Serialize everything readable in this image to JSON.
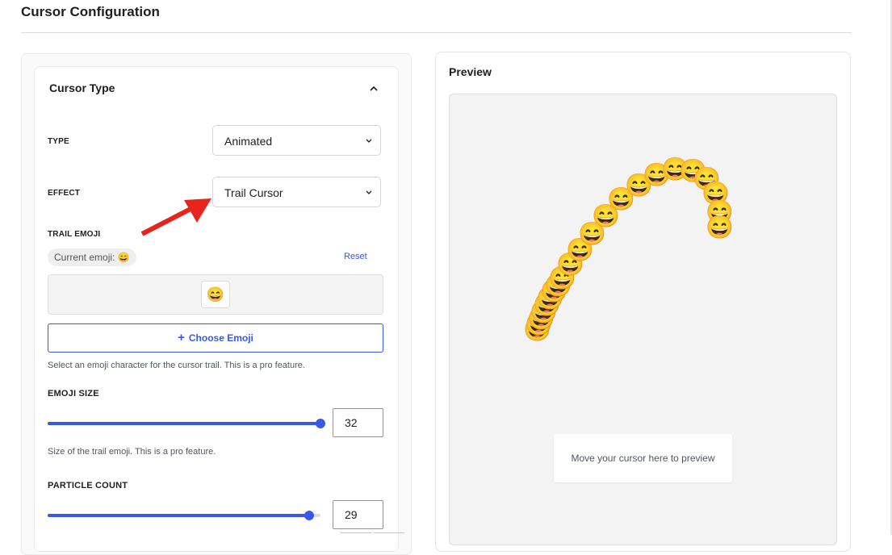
{
  "page": {
    "title": "Cursor Configuration"
  },
  "cursor_type": {
    "title": "Cursor Type",
    "type": {
      "label": "TYPE",
      "value": "Animated"
    },
    "effect": {
      "label": "EFFECT",
      "value": "Trail Cursor"
    },
    "trail_emoji": {
      "label": "TRAIL EMOJI",
      "current_label": "Current emoji: 😄",
      "reset_label": "Reset",
      "selected_emoji": "😄",
      "choose_button": "Choose Emoji",
      "help": "Select an emoji character for the cursor trail. This is a pro feature."
    },
    "emoji_size": {
      "label": "EMOJI SIZE",
      "value": "32",
      "slider_fraction": 1.0,
      "help": "Size of the trail emoji. This is a pro feature."
    },
    "particle_count": {
      "label": "PARTICLE COUNT",
      "value": "29",
      "slider_fraction": 0.96
    }
  },
  "preview": {
    "title": "Preview",
    "hint": "Move your cursor here to preview",
    "trail_emoji": "😄"
  },
  "colors": {
    "accent": "#3858e9",
    "annotation_arrow": "#e8231b"
  }
}
